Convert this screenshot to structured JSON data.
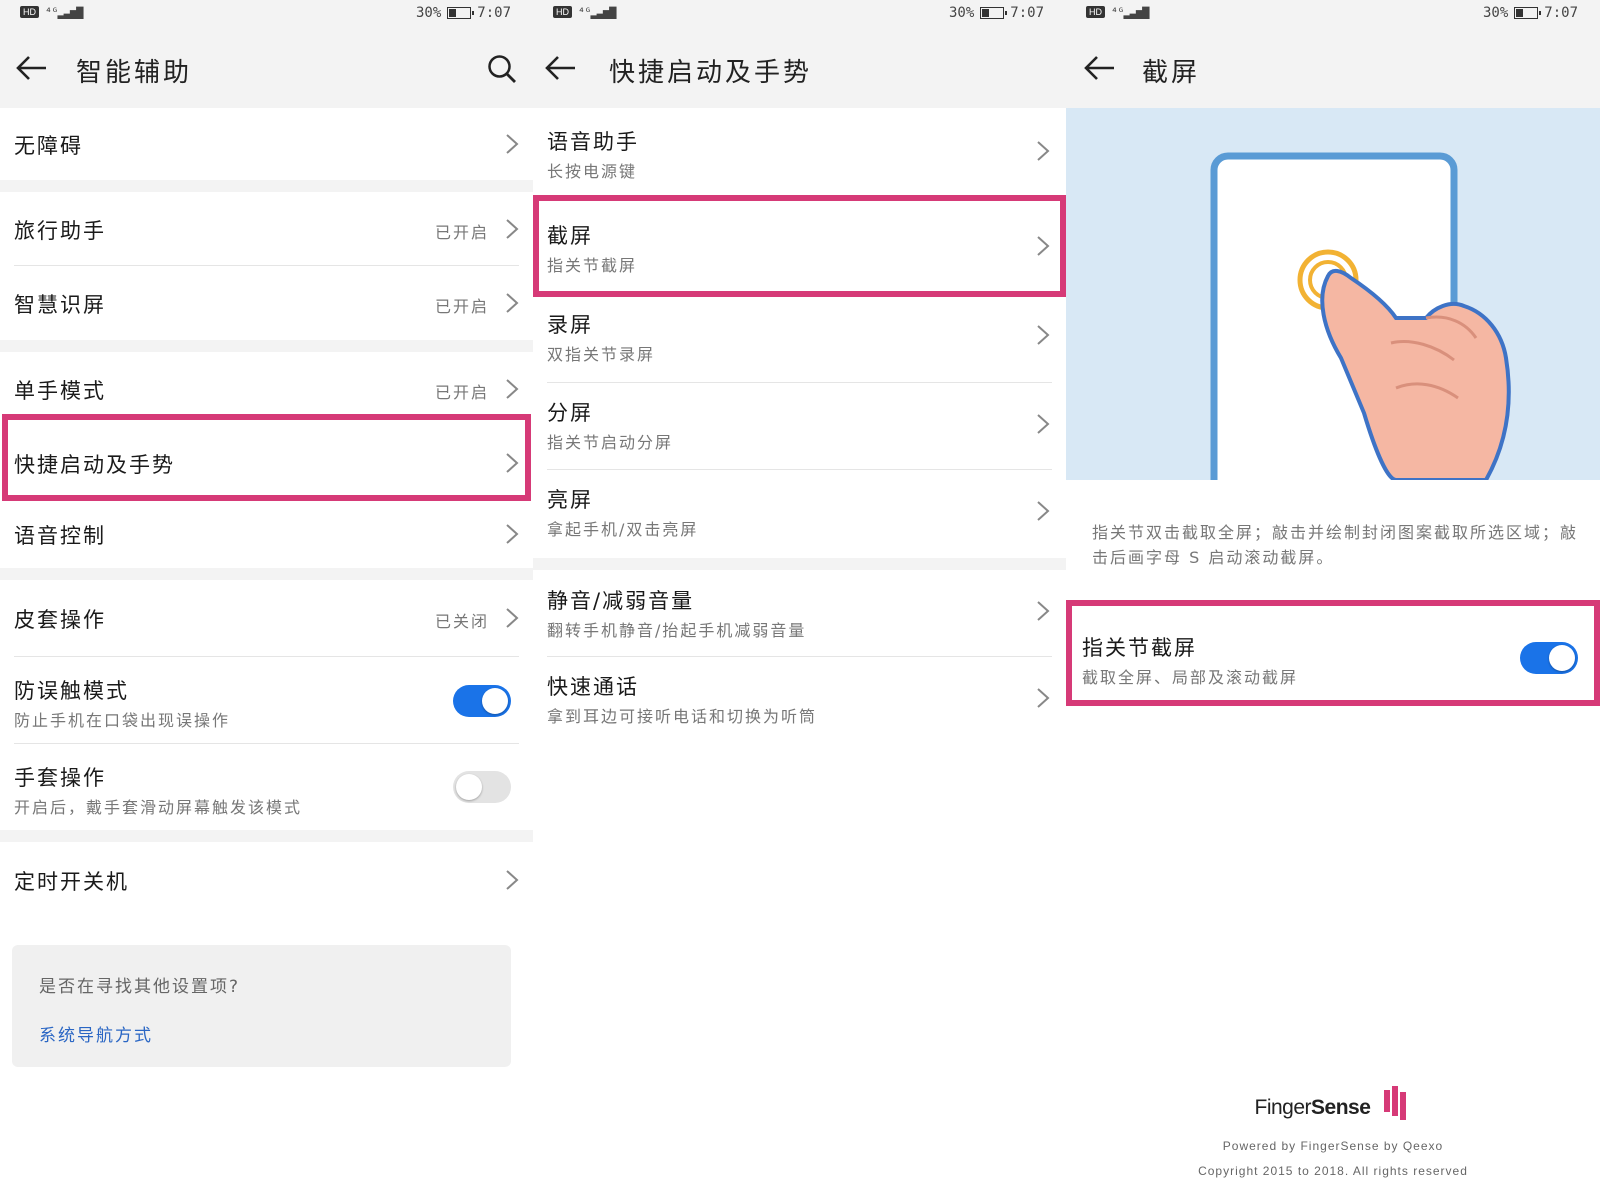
{
  "status_bar": {
    "hd": "HD",
    "network": "4G",
    "battery": "30%",
    "time": "7:07"
  },
  "panel1": {
    "title": "智能辅助",
    "items": [
      {
        "label": "无障碍"
      },
      {
        "label": "旅行助手",
        "status": "已开启"
      },
      {
        "label": "智慧识屏",
        "status": "已开启"
      },
      {
        "label": "单手模式",
        "status": "已开启"
      },
      {
        "label": "快捷启动及手势"
      },
      {
        "label": "语音控制"
      },
      {
        "label": "皮套操作",
        "status": "已关闭"
      },
      {
        "label": "防误触模式",
        "sub": "防止手机在口袋出现误操作",
        "toggle": true
      },
      {
        "label": "手套操作",
        "sub": "开启后，戴手套滑动屏幕触发该模式",
        "toggle": false
      },
      {
        "label": "定时开关机"
      }
    ],
    "search_card": {
      "question": "是否在寻找其他设置项?",
      "link": "系统导航方式"
    }
  },
  "panel2": {
    "title": "快捷启动及手势",
    "items": [
      {
        "label": "语音助手",
        "sub": "长按电源键"
      },
      {
        "label": "截屏",
        "sub": "指关节截屏"
      },
      {
        "label": "录屏",
        "sub": "双指关节录屏"
      },
      {
        "label": "分屏",
        "sub": "指关节启动分屏"
      },
      {
        "label": "亮屏",
        "sub": "拿起手机/双击亮屏"
      },
      {
        "label": "静音/减弱音量",
        "sub": "翻转手机静音/抬起手机减弱音量"
      },
      {
        "label": "快速通话",
        "sub": "拿到耳边可接听电话和切换为听筒"
      }
    ]
  },
  "panel3": {
    "title": "截屏",
    "description": "指关节双击截取全屏；敲击并绘制封闭图案截取所选区域；敲击后画字母 S 启动滚动截屏。",
    "setting": {
      "label": "指关节截屏",
      "sub": "截取全屏、局部及滚动截屏",
      "toggle": true
    },
    "brand": {
      "name_light": "Finger",
      "name_bold": "Sense"
    },
    "powered_by": "Powered by FingerSense by Qeexo",
    "copyright": "Copyright 2015 to 2018. All rights reserved"
  },
  "colors": {
    "highlight": "#d63a77",
    "toggle_on": "#1a73e8",
    "link": "#2a66c4",
    "illustration_bg": "#d8e8f5"
  },
  "icons": {
    "back": "arrow-left-icon",
    "search": "search-icon",
    "chevron": "chevron-right-icon"
  }
}
